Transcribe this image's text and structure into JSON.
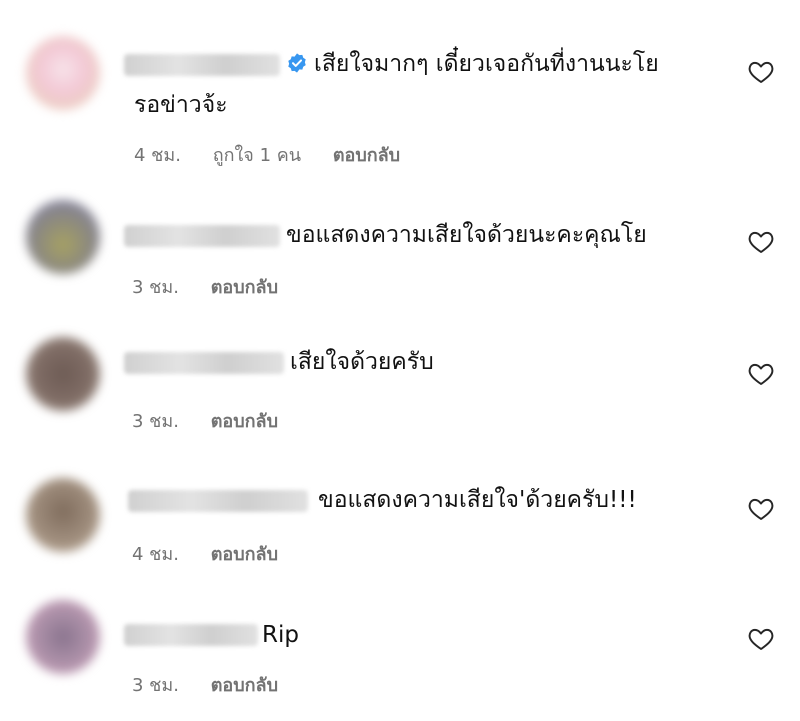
{
  "comments": [
    {
      "text_line1": "เสียใจมากๆ เดี๋ยวเจอกันที่งานนะโย",
      "text_line2": "รอข่าวจ้ะ",
      "verified": true,
      "time": "4 ชม.",
      "likes": "ถูกใจ 1 คน",
      "reply": "ตอบกลับ",
      "avatar_colors": [
        "#f3c9d6",
        "#e7d2b4"
      ],
      "icon": "heart-outline-icon"
    },
    {
      "text_line1": "ขอแสดงความเสียใจด้วยนะคะคุณโย",
      "time": "3 ชม.",
      "reply": "ตอบกลับ",
      "avatar_colors": [
        "#7f7fb2",
        "#a6a163"
      ],
      "icon": "heart-outline-icon"
    },
    {
      "text_line1": "เสียใจด้วยครับ",
      "time": "3 ชม.",
      "reply": "ตอบกลับ",
      "avatar_colors": [
        "#7d6a63",
        "#a39489"
      ],
      "icon": "heart-outline-icon"
    },
    {
      "text_line1": "ขอแสดงความเสียใจ'ด้วยครับ!!!",
      "time": "4 ชม.",
      "reply": "ตอบกลับ",
      "avatar_colors": [
        "#806d5d",
        "#c1b09c"
      ],
      "icon": "heart-outline-icon"
    },
    {
      "text_line1": "Rip",
      "time": "3 ชม.",
      "reply": "ตอบกลับ",
      "avatar_colors": [
        "#8a748e",
        "#d6a9c2"
      ],
      "icon": "heart-outline-icon"
    }
  ],
  "colors": {
    "text": "#111111",
    "meta": "#737373",
    "verified_badge": "#3897f0"
  }
}
